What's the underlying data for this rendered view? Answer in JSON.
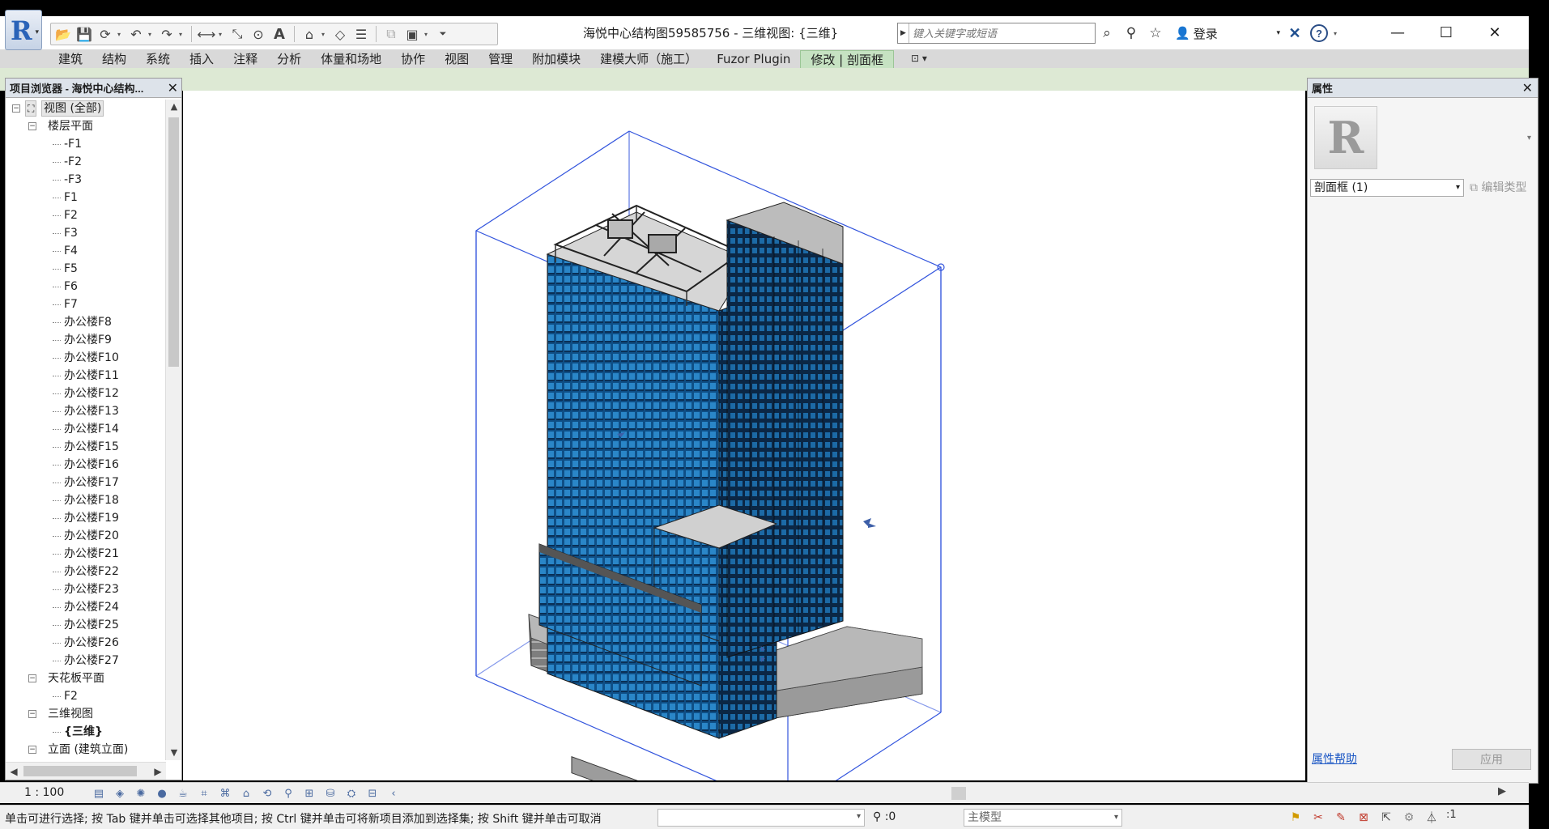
{
  "titlebar": {
    "doc_title": "海悦中心结构图59585756 - 三维视图: {三维}",
    "search_placeholder": "键入关键字或短语",
    "login_label": "登录",
    "window": {
      "minimize": "—",
      "maximize": "☐",
      "close": "✕"
    }
  },
  "quick_access": {
    "icons": [
      "open-icon",
      "save-icon",
      "sync-icon",
      "undo-icon",
      "redo-icon",
      "measure-icon",
      "dimension-icon",
      "tag-icon",
      "text-icon",
      "3d-view-icon",
      "section-icon",
      "thin-lines-icon",
      "close-hidden-icon",
      "switch-windows-icon",
      "customize-icon"
    ]
  },
  "ribbon": {
    "tabs": [
      "建筑",
      "结构",
      "系统",
      "插入",
      "注释",
      "分析",
      "体量和场地",
      "协作",
      "视图",
      "管理",
      "附加模块",
      "建模大师（施工）",
      "Fuzor Plugin",
      "修改 | 剖面框"
    ],
    "active_tab": "修改 | 剖面框"
  },
  "browser": {
    "title": "项目浏览器 - 海悦中心结构...",
    "nodes": [
      {
        "label": "视图 (全部)",
        "level": 0,
        "toggle": "−",
        "selected": true
      },
      {
        "label": "楼层平面",
        "level": 1,
        "toggle": "−"
      },
      {
        "label": "-F1",
        "level": 2
      },
      {
        "label": "-F2",
        "level": 2
      },
      {
        "label": "-F3",
        "level": 2
      },
      {
        "label": "F1",
        "level": 2
      },
      {
        "label": "F2",
        "level": 2
      },
      {
        "label": "F3",
        "level": 2
      },
      {
        "label": "F4",
        "level": 2
      },
      {
        "label": "F5",
        "level": 2
      },
      {
        "label": "F6",
        "level": 2
      },
      {
        "label": "F7",
        "level": 2
      },
      {
        "label": "办公楼F8",
        "level": 2
      },
      {
        "label": "办公楼F9",
        "level": 2
      },
      {
        "label": "办公楼F10",
        "level": 2
      },
      {
        "label": "办公楼F11",
        "level": 2
      },
      {
        "label": "办公楼F12",
        "level": 2
      },
      {
        "label": "办公楼F13",
        "level": 2
      },
      {
        "label": "办公楼F14",
        "level": 2
      },
      {
        "label": "办公楼F15",
        "level": 2
      },
      {
        "label": "办公楼F16",
        "level": 2
      },
      {
        "label": "办公楼F17",
        "level": 2
      },
      {
        "label": "办公楼F18",
        "level": 2
      },
      {
        "label": "办公楼F19",
        "level": 2
      },
      {
        "label": "办公楼F20",
        "level": 2
      },
      {
        "label": "办公楼F21",
        "level": 2
      },
      {
        "label": "办公楼F22",
        "level": 2
      },
      {
        "label": "办公楼F23",
        "level": 2
      },
      {
        "label": "办公楼F24",
        "level": 2
      },
      {
        "label": "办公楼F25",
        "level": 2
      },
      {
        "label": "办公楼F26",
        "level": 2
      },
      {
        "label": "办公楼F27",
        "level": 2
      },
      {
        "label": "天花板平面",
        "level": 1,
        "toggle": "−"
      },
      {
        "label": "F2",
        "level": 2
      },
      {
        "label": "三维视图",
        "level": 1,
        "toggle": "−"
      },
      {
        "label": "{三维}",
        "level": 2,
        "bold": true
      },
      {
        "label": "立面 (建筑立面)",
        "level": 1,
        "toggle": "−"
      }
    ]
  },
  "properties": {
    "title": "属性",
    "type_selector": "剖面框 (1)",
    "edit_type": "编辑类型",
    "help_link": "属性帮助",
    "apply": "应用"
  },
  "viewbar": {
    "scale": "1 : 100",
    "icons": [
      "detail-level-icon",
      "visual-style-icon",
      "sun-path-icon",
      "shadows-icon",
      "render-icon",
      "crop-view-icon",
      "show-crop-icon",
      "lock-view-icon",
      "temp-hide-icon",
      "reveal-hidden-icon",
      "temp-view-props-icon",
      "analysis-display-icon",
      "highlight-displacement-icon",
      "constraints-icon",
      "collapse-icon"
    ]
  },
  "statusbar": {
    "message": "单击可进行选择; 按 Tab 键并单击可选择其他项目; 按 Ctrl 键并单击可将新项目添加到选择集; 按 Shift 键并单击可取消",
    "selection_count": ":0",
    "workset": "主模型",
    "filter_count": ":1"
  },
  "colors": {
    "ribbon_active": "#c6e2c2",
    "section_box": "#3355dd",
    "glass": "#1d6aa8"
  }
}
